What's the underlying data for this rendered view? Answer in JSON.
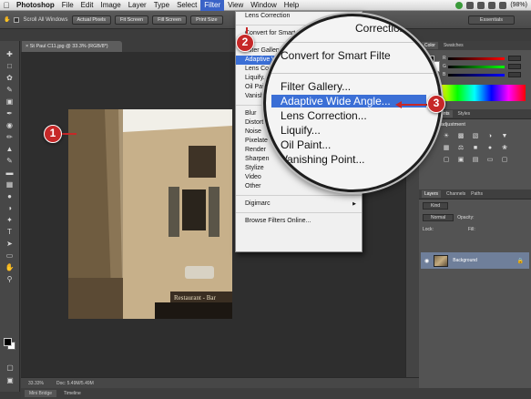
{
  "menubar": {
    "apple": "",
    "items": [
      "Photoshop",
      "File",
      "Edit",
      "Image",
      "Layer",
      "Type",
      "Select",
      "Filter",
      "View",
      "Window",
      "Help"
    ],
    "active": "Filter",
    "battery": "(98%)"
  },
  "optbar": {
    "scroll_all_windows": "Scroll All Windows",
    "actual_pixels": "Actual Pixels",
    "fit_screen": "Fit Screen",
    "fill_screen": "Fill Screen",
    "print_size": "Print Size",
    "workspace": "Essentials"
  },
  "doc": {
    "tab_title": "St Paul C11.jpg @ 33.3% (RGB/8*)",
    "zoom": "33.33%",
    "doc_size": "Doc: 5.49M/5.49M"
  },
  "photo": {
    "sign_text": "Restaurant - Bar"
  },
  "bottom_tabs": [
    "Mini Bridge",
    "Timeline"
  ],
  "filter_menu": {
    "items": [
      {
        "label": "Lens Correction",
        "shortcut": "⌘F",
        "highlight": false,
        "submenu": false
      },
      {
        "sep": true
      },
      {
        "label": "Convert for Smart Filters",
        "shortcut": "",
        "highlight": false,
        "submenu": false
      },
      {
        "sep": true
      },
      {
        "label": "Filter Gallery...",
        "shortcut": "",
        "highlight": false,
        "submenu": false
      },
      {
        "label": "Adaptive Wide Angle...",
        "shortcut": "",
        "highlight": true,
        "submenu": false
      },
      {
        "label": "Lens Correction...",
        "shortcut": "",
        "highlight": false,
        "submenu": false
      },
      {
        "label": "Liquify...",
        "shortcut": "",
        "highlight": false,
        "submenu": false
      },
      {
        "label": "Oil Paint...",
        "shortcut": "",
        "highlight": false,
        "submenu": false
      },
      {
        "label": "Vanishing Point...",
        "shortcut": "",
        "highlight": false,
        "submenu": false
      },
      {
        "sep": true
      },
      {
        "label": "Blur",
        "shortcut": "",
        "highlight": false,
        "submenu": true
      },
      {
        "label": "Distort",
        "shortcut": "",
        "highlight": false,
        "submenu": true
      },
      {
        "label": "Noise",
        "shortcut": "",
        "highlight": false,
        "submenu": true
      },
      {
        "label": "Pixelate",
        "shortcut": "",
        "highlight": false,
        "submenu": true
      },
      {
        "label": "Render",
        "shortcut": "",
        "highlight": false,
        "submenu": true
      },
      {
        "label": "Sharpen",
        "shortcut": "",
        "highlight": false,
        "submenu": true
      },
      {
        "label": "Stylize",
        "shortcut": "",
        "highlight": false,
        "submenu": true
      },
      {
        "label": "Video",
        "shortcut": "",
        "highlight": false,
        "submenu": true
      },
      {
        "label": "Other",
        "shortcut": "",
        "highlight": false,
        "submenu": true
      },
      {
        "sep": true
      },
      {
        "label": "Digimarc",
        "shortcut": "",
        "highlight": false,
        "submenu": true
      },
      {
        "sep": true
      },
      {
        "label": "Browse Filters Online...",
        "shortcut": "",
        "highlight": false,
        "submenu": false
      }
    ]
  },
  "magnifier": {
    "items": [
      "Correction",
      "Convert for Smart Filte",
      "Filter Gallery...",
      "Adaptive Wide Angle...",
      "Lens Correction...",
      "Liquify...",
      "Oil Paint...",
      "Vanishing Point..."
    ],
    "highlight_index": 3
  },
  "callouts": [
    "1",
    "2",
    "3"
  ],
  "panels": {
    "color_tabs": [
      "Color",
      "Swatches"
    ],
    "channel_labels": [
      "R",
      "G",
      "B"
    ],
    "adj_tabs": [
      "Adjustments",
      "Styles"
    ],
    "adj_header": "Add an adjustment",
    "layers_tabs": [
      "Layers",
      "Channels",
      "Paths"
    ],
    "kind": "Kind",
    "blend_mode": "Normal",
    "opacity_label": "Opacity:",
    "lock_label": "Lock:",
    "fill_label": "Fill:",
    "layer_name": "Background"
  },
  "colors": {
    "highlight": "#3b6fd6",
    "callout": "#c62828"
  }
}
